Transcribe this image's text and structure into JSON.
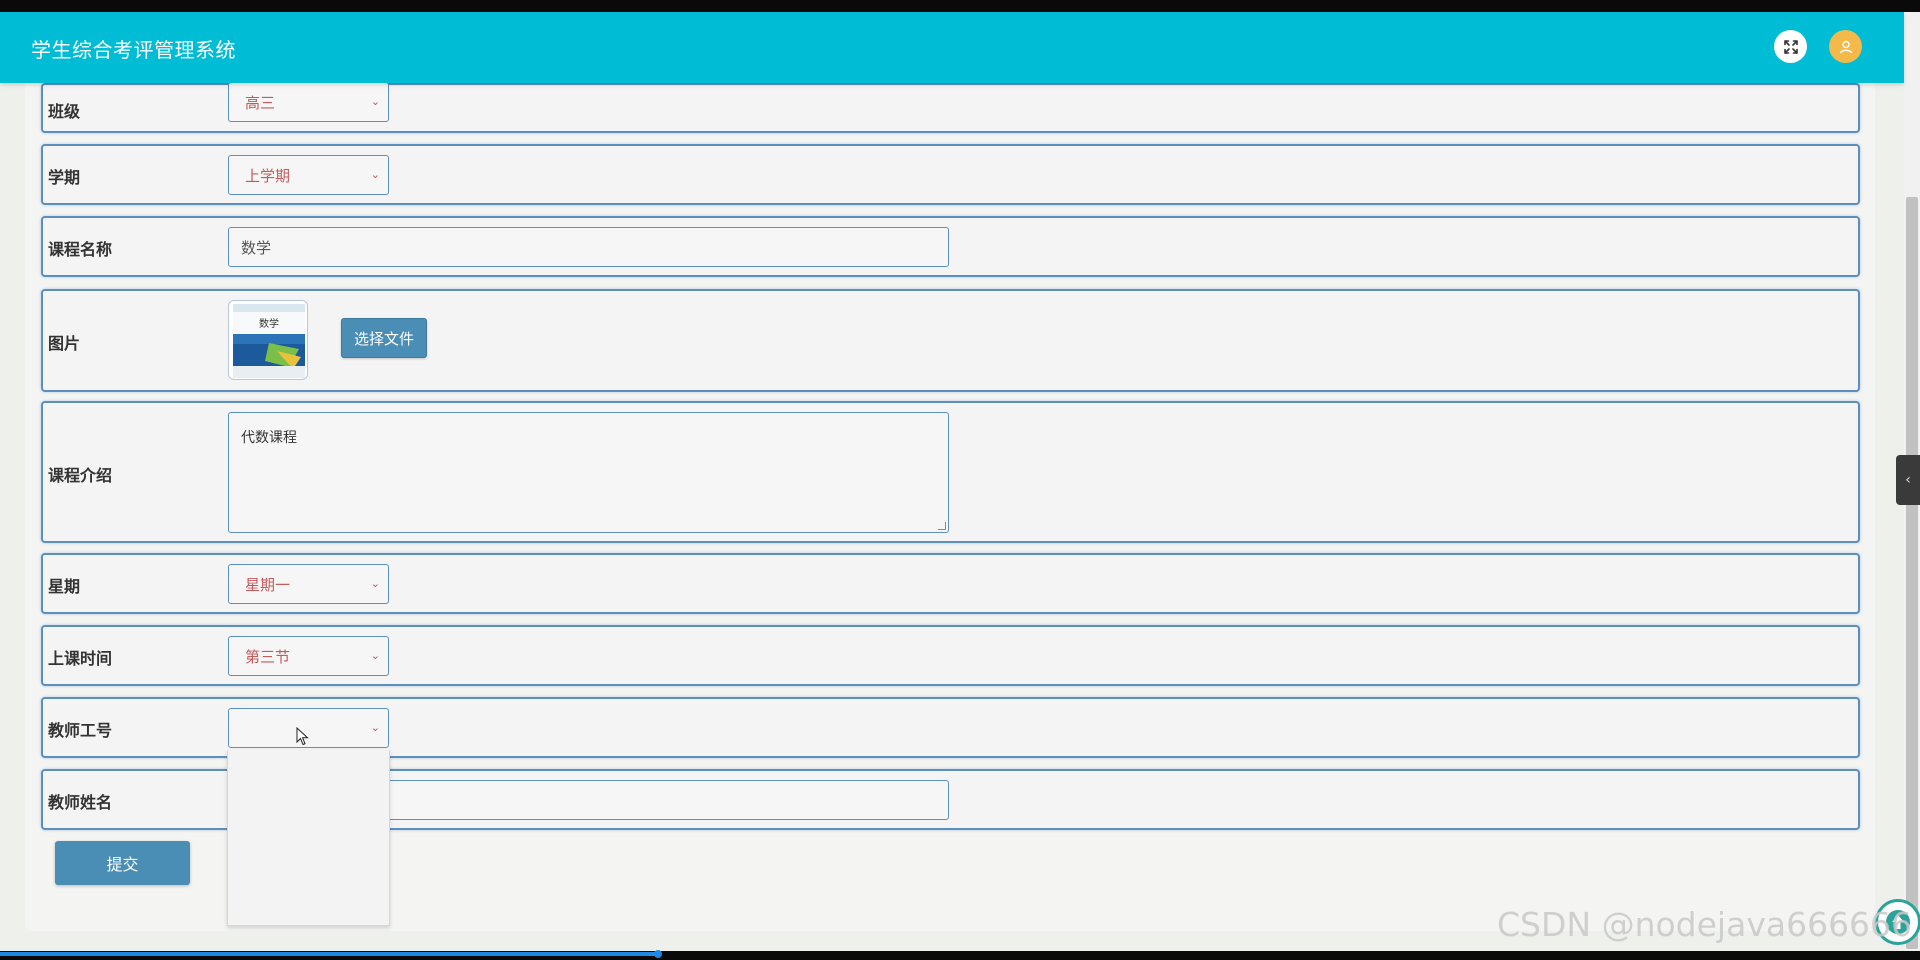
{
  "header": {
    "title": "学生综合考评管理系统",
    "fullscreen_icon": "expand-arrows-icon",
    "user_icon": "user-icon"
  },
  "form": {
    "rows": [
      {
        "label": "班级",
        "type": "select",
        "value": "高三"
      },
      {
        "label": "学期",
        "type": "select",
        "value": "上学期"
      },
      {
        "label": "课程名称",
        "type": "input",
        "value": "数学"
      },
      {
        "label": "图片",
        "type": "file",
        "button": "选择文件",
        "thumb_text": "数学"
      },
      {
        "label": "课程介绍",
        "type": "textarea",
        "value": "代数课程"
      },
      {
        "label": "星期",
        "type": "select",
        "value": "星期一"
      },
      {
        "label": "上课时间",
        "type": "select",
        "value": "第三节"
      },
      {
        "label": "教师工号",
        "type": "select",
        "value": ""
      },
      {
        "label": "教师姓名",
        "type": "input",
        "value": ""
      }
    ],
    "submit_label": "提交"
  },
  "watermark": "CSDN @nodejava666666",
  "colors": {
    "header": "#00bcd4",
    "primary_button": "#4a8db5",
    "row_border": "#5a8fc0",
    "select_text": "#c45a5a",
    "user_avatar": "#f5b94a"
  },
  "icons": {
    "side_toggle": "chevron-left-icon",
    "back_to_top": "arrow-up-circle-icon",
    "cursor": "mouse-pointer-icon"
  }
}
